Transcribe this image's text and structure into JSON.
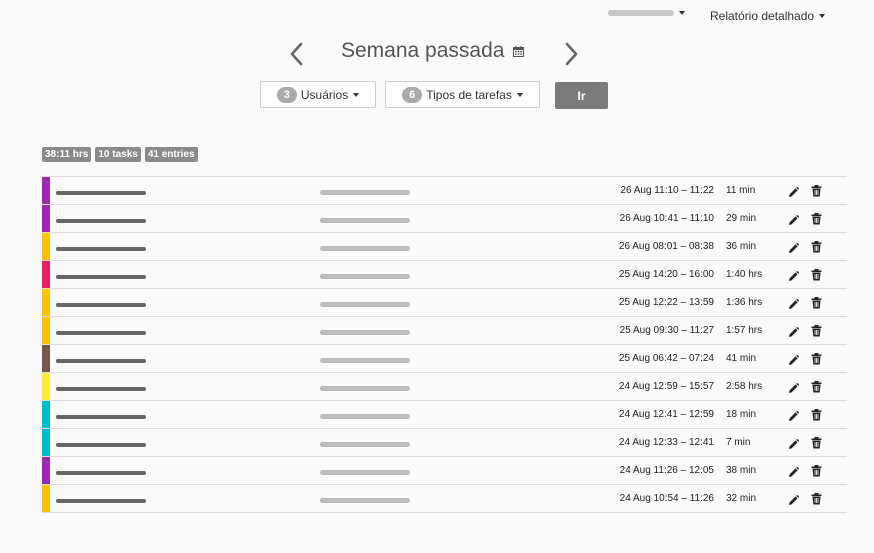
{
  "header": {
    "user_menu_label": "",
    "report_menu_label": "Relatório detalhado"
  },
  "period": {
    "title": "Semana passada"
  },
  "filters": {
    "users": {
      "count": "3",
      "label": "Usuários"
    },
    "task_types": {
      "count": "6",
      "label": "Tipos de tarefas"
    },
    "go_label": "Ir"
  },
  "summary": {
    "hours": "38:11 hrs",
    "tasks": "10 tasks",
    "entries": "41 entries"
  },
  "entries": [
    {
      "color": "#9c27b0",
      "time_range": "26 Aug 11:10 – 11:22",
      "duration": "11 min"
    },
    {
      "color": "#9c27b0",
      "time_range": "26 Aug 10:41 – 11:10",
      "duration": "29 min"
    },
    {
      "color": "#ffc107",
      "time_range": "26 Aug 08:01 – 08:38",
      "duration": "36 min"
    },
    {
      "color": "#e91e63",
      "time_range": "25 Aug 14:20 – 16:00",
      "duration": "1:40 hrs"
    },
    {
      "color": "#ffc107",
      "time_range": "25 Aug 12:22 – 13:59",
      "duration": "1:36 hrs"
    },
    {
      "color": "#ffc107",
      "time_range": "25 Aug 09:30 – 11:27",
      "duration": "1:57 hrs"
    },
    {
      "color": "#795548",
      "time_range": "25 Aug 06:42 – 07:24",
      "duration": "41 min"
    },
    {
      "color": "#ffeb3b",
      "time_range": "24 Aug 12:59 – 15:57",
      "duration": "2:58 hrs"
    },
    {
      "color": "#00bcd4",
      "time_range": "24 Aug 12:41 – 12:59",
      "duration": "18 min"
    },
    {
      "color": "#00bcd4",
      "time_range": "24 Aug 12:33 – 12:41",
      "duration": "7 min"
    },
    {
      "color": "#9c27b0",
      "time_range": "24 Aug 11:26 – 12:05",
      "duration": "38 min"
    },
    {
      "color": "#ffc107",
      "time_range": "24 Aug 10:54 – 11:26",
      "duration": "32 min"
    }
  ],
  "icons": {
    "prev": "chevron-left-icon",
    "next": "chevron-right-icon",
    "calendar": "calendar-icon",
    "edit": "pencil-icon",
    "delete": "trash-icon"
  }
}
